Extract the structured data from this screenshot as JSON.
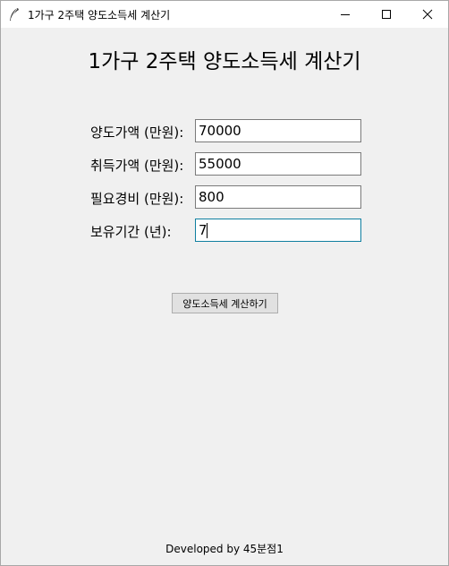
{
  "window": {
    "title": "1가구 2주택 양도소득세 계산기",
    "controls": {
      "minimize_icon": "minimize-icon",
      "maximize_icon": "maximize-icon",
      "close_icon": "close-icon"
    }
  },
  "main": {
    "heading": "1가구 2주택 양도소득세 계산기",
    "fields": [
      {
        "label": "양도가액 (만원):",
        "value": "70000"
      },
      {
        "label": "취득가액 (만원):",
        "value": "55000"
      },
      {
        "label": "필요경비 (만원):",
        "value": "800"
      },
      {
        "label": "보유기간 (년):",
        "value": "7"
      }
    ],
    "calculate_label": "양도소득세 계산하기"
  },
  "footer": {
    "text": "Developed by 45분점1"
  },
  "colors": {
    "background": "#f0f0f0",
    "titlebar": "#ffffff",
    "focus_border": "#0f7fa0",
    "button_bg": "#e1e1e1"
  }
}
